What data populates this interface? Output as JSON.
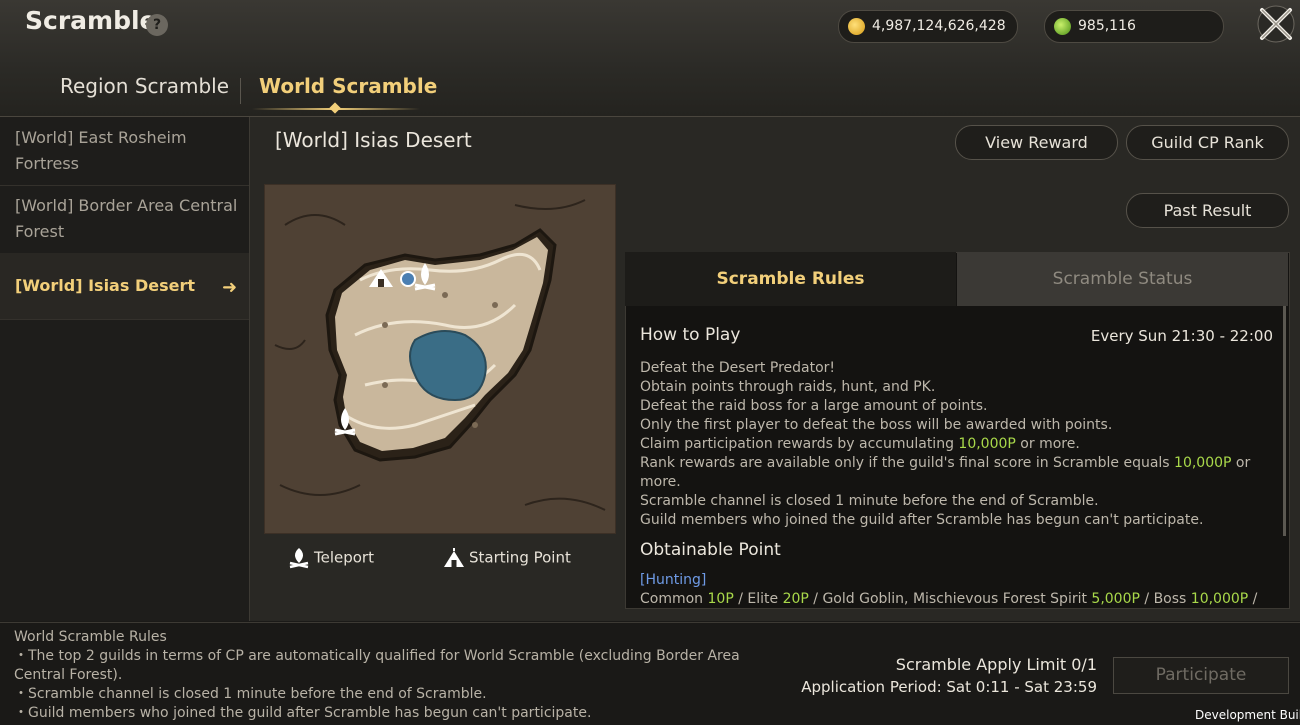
{
  "header": {
    "title": "Scramble",
    "help_label": "?",
    "gold_amount": "4,987,124,626,428",
    "gem_amount": "985,116"
  },
  "tabs": [
    {
      "label": "Region Scramble",
      "active": false
    },
    {
      "label": "World Scramble",
      "active": true
    }
  ],
  "sidebar": {
    "items": [
      {
        "label": "[World] East Rosheim Fortress"
      },
      {
        "label": "[World] Border Area Central Forest"
      },
      {
        "label": "[World] Isias Desert",
        "selected": true
      }
    ]
  },
  "main": {
    "title": "[World] Isias Desert",
    "view_reward": "View Reward",
    "guild_cp_rank": "Guild CP Rank",
    "past_result": "Past Result"
  },
  "legend": {
    "teleport": "Teleport",
    "starting_point": "Starting Point"
  },
  "rules_panel": {
    "tab_rules": "Scramble Rules",
    "tab_status": "Scramble Status",
    "how_to_play": "How to Play",
    "schedule": "Every Sun 21:30 - 22:00",
    "line1": "Defeat the Desert Predator!",
    "line2": "Obtain points through raids, hunt, and PK.",
    "line3": "Defeat the raid boss for a large amount of points.",
    "line4": "Only the first player to defeat the boss will be awarded with points.",
    "line5a": "Claim participation rewards by accumulating ",
    "line5b": "10,000P",
    "line5c": " or more.",
    "line6a": "Rank rewards are available only if the guild's final score in Scramble equals ",
    "line6b": "10,000P",
    "line6c": " or more.",
    "line7": "Scramble channel is closed 1 minute before the end of Scramble.",
    "line8": "Guild members who joined the guild after Scramble has begun can't participate.",
    "obtainable_point": "Obtainable Point",
    "hunting_label": "[Hunting]",
    "hunting": {
      "common": "Common ",
      "common_p": "10P",
      "elite": " / Elite ",
      "elite_p": "20P",
      "gold": " / Gold Goblin, Mischievous Forest Spirit ",
      "gold_p": "5,000P",
      "boss": " / Boss ",
      "boss_p": "10,000P",
      "tail": " /"
    }
  },
  "bottom": {
    "rules_title": "World Scramble Rules",
    "rule1": "・The top 2 guilds in terms of CP are automatically qualified for World Scramble (excluding Border Area Central Forest).",
    "rule2": "・Scramble channel is closed 1 minute before the end of Scramble.",
    "rule3": "・Guild members who joined the guild after Scramble has begun can't participate.",
    "apply_limit": "Scramble Apply Limit 0/1",
    "application_period": "Application Period: Sat 0:11 - Sat 23:59",
    "participate": "Participate",
    "dev_build": "Development Build"
  },
  "colors": {
    "accent_gold": "#f2cf7a",
    "highlight_green": "#a9d94a",
    "link_blue": "#6f9be6"
  },
  "icons": [
    "help-icon",
    "gold-coin-icon",
    "gem-coin-icon",
    "close-icon",
    "arrow-right-icon",
    "campfire-icon",
    "tent-icon"
  ]
}
